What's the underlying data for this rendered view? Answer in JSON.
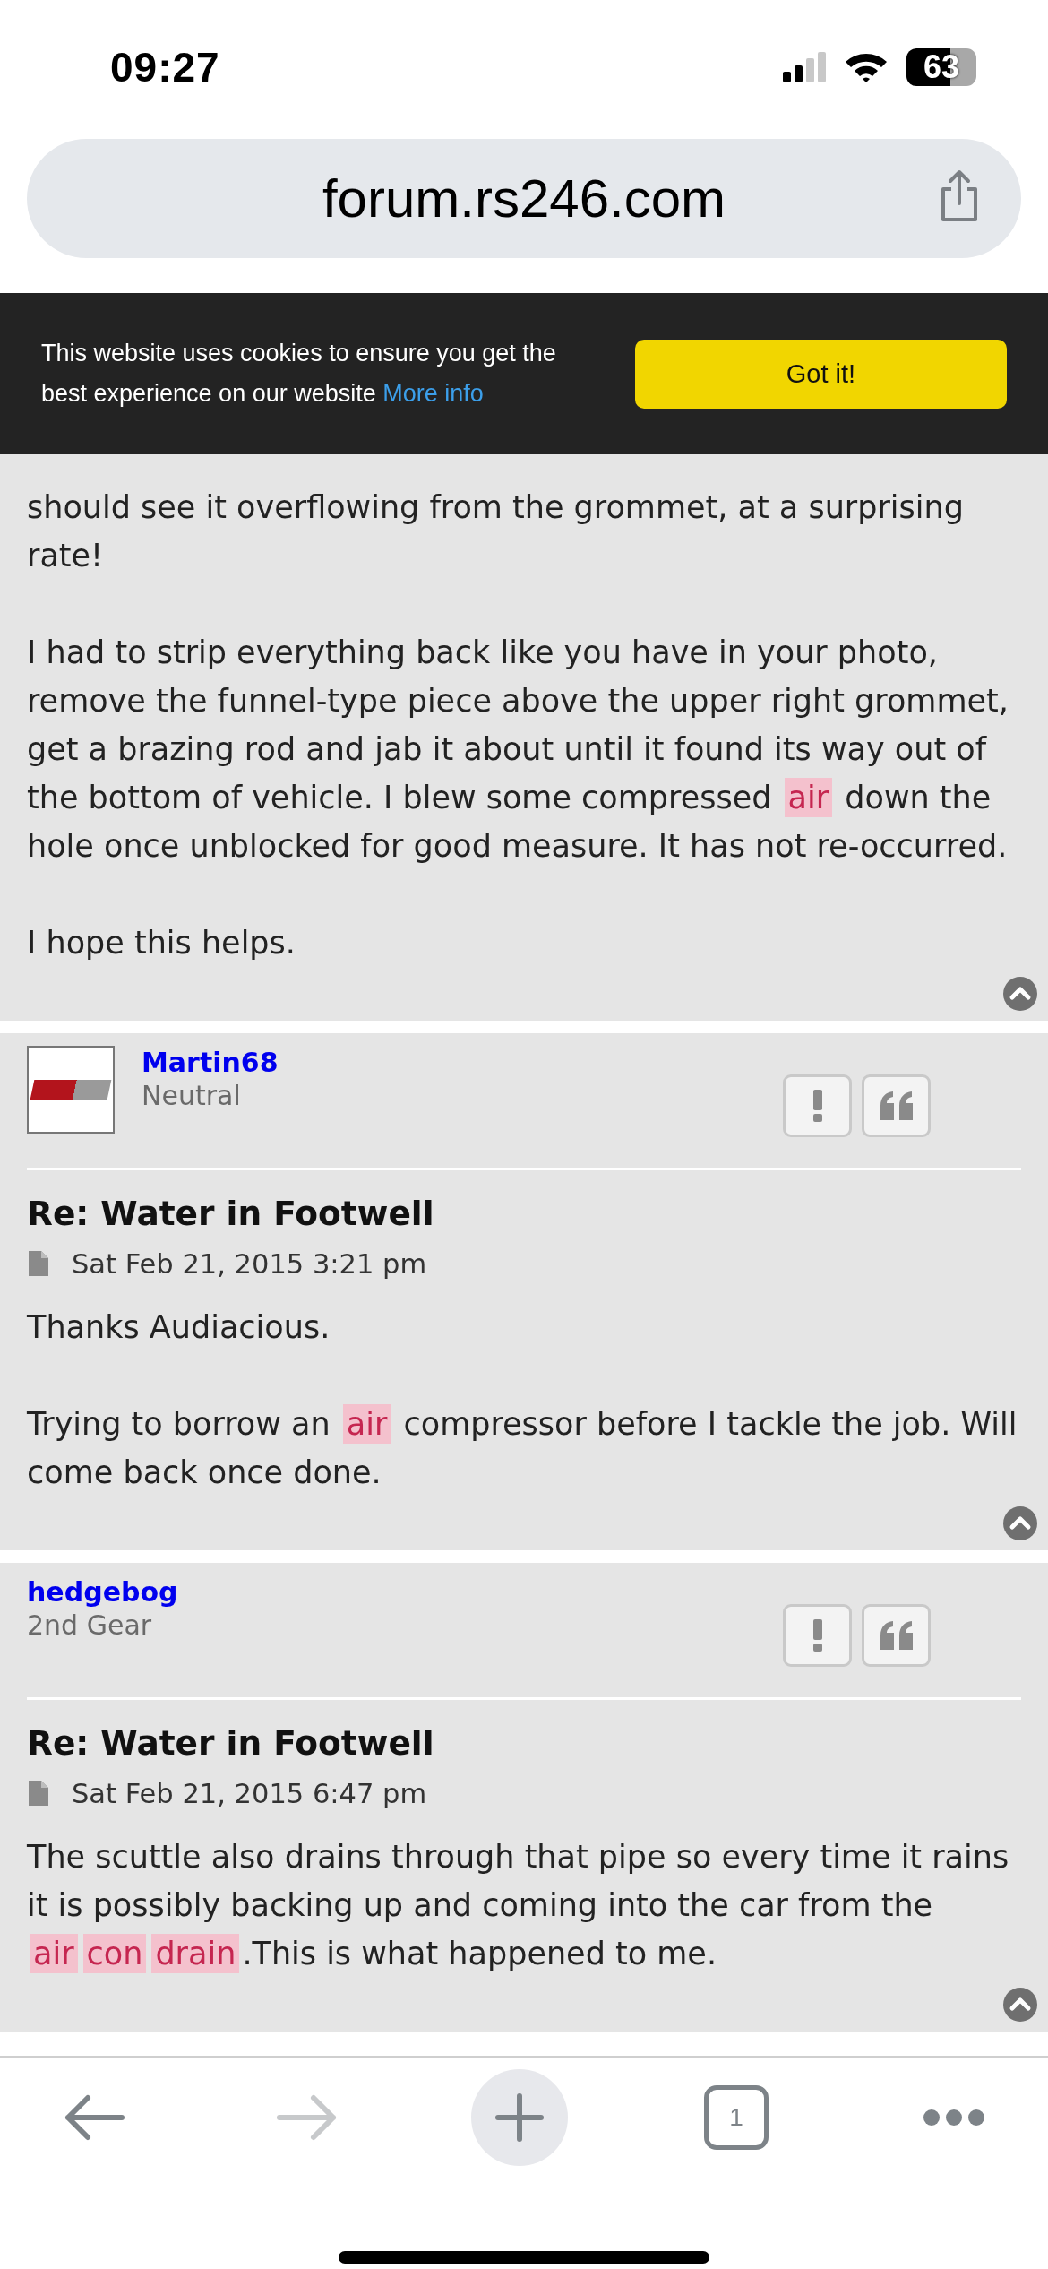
{
  "status_bar": {
    "time": "09:27",
    "battery": "63"
  },
  "address_bar": {
    "url": "forum.rs246.com"
  },
  "cookie_banner": {
    "message": "This website uses cookies to ensure you get the best experience on our website",
    "link": "More info",
    "button": "Got it!"
  },
  "posts": [
    {
      "has_header": false,
      "paragraphs": [
        [
          {
            "text": "should see it overflowing from the grommet, at a surprising rate!",
            "highlight": false
          }
        ],
        [
          {
            "text": "I had to strip everything back like you have in your photo, remove the funnel-type piece above the upper right grommet, get a brazing rod and jab it about until it found its way out of the bottom of vehicle. I blew some compressed ",
            "highlight": false
          },
          {
            "text": "air",
            "highlight": true
          },
          {
            "text": " down the hole once unblocked for good measure. It has not re-occurred.",
            "highlight": false
          }
        ],
        [
          {
            "text": "I hope this helps.",
            "highlight": false
          }
        ]
      ]
    },
    {
      "has_header": true,
      "has_avatar": true,
      "author": "Martin68",
      "rank": "Neutral",
      "title": "Re: Water in Footwell",
      "date": "Sat Feb 21, 2015 3:21 pm",
      "paragraphs": [
        [
          {
            "text": "Thanks Audiacious.",
            "highlight": false
          }
        ],
        [
          {
            "text": "Trying to borrow an ",
            "highlight": false
          },
          {
            "text": "air",
            "highlight": true
          },
          {
            "text": " compressor before I tackle the job. Will come back once done.",
            "highlight": false
          }
        ]
      ]
    },
    {
      "has_header": true,
      "has_avatar": false,
      "author": "hedgebog",
      "rank": "2nd Gear",
      "title": "Re: Water in Footwell",
      "date": "Sat Feb 21, 2015 6:47 pm",
      "paragraphs": [
        [
          {
            "text": "The scuttle also drains through that pipe so every time it rains it is possibly backing up and coming into the car from the ",
            "highlight": false
          },
          {
            "text": "air",
            "highlight": true
          },
          {
            "text": "con",
            "highlight": true
          },
          {
            "text": "drain",
            "highlight": true
          },
          {
            "text": ".This is what happened to me.",
            "highlight": false
          }
        ]
      ]
    }
  ],
  "toolbar": [
    {
      "kind": "back",
      "disabled": false
    },
    {
      "kind": "forward",
      "disabled": true
    },
    {
      "kind": "new-tab",
      "disabled": false
    },
    {
      "kind": "tabs",
      "count": "1",
      "disabled": false
    },
    {
      "kind": "more",
      "disabled": false
    }
  ]
}
